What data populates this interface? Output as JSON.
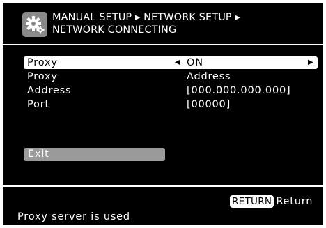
{
  "header": {
    "icon": "gear-icon",
    "breadcrumb_line1": "MANUAL SETUP ▸ NETWORK SETUP ▸",
    "breadcrumb_line2": "NETWORK CONNECTING"
  },
  "menu": {
    "rows": [
      {
        "label": "Proxy",
        "value": "ON",
        "selected": true
      },
      {
        "label": "Proxy",
        "value": "Address",
        "selected": false
      },
      {
        "label": "Address",
        "value": "[000.000.000.000]",
        "selected": false
      },
      {
        "label": "Port",
        "value": "[00000]",
        "selected": false
      }
    ],
    "arrow_left": "◀",
    "arrow_right": "▶",
    "exit_label": "Exit"
  },
  "footer": {
    "return_key": "RETURN",
    "return_label": "Return",
    "status_text": "Proxy server is used"
  },
  "colors": {
    "background": "#000000",
    "text": "#ffffff",
    "highlight": "#ffffff",
    "exit_button": "#9a9a9a",
    "icon_box": "#8a8a8a"
  }
}
